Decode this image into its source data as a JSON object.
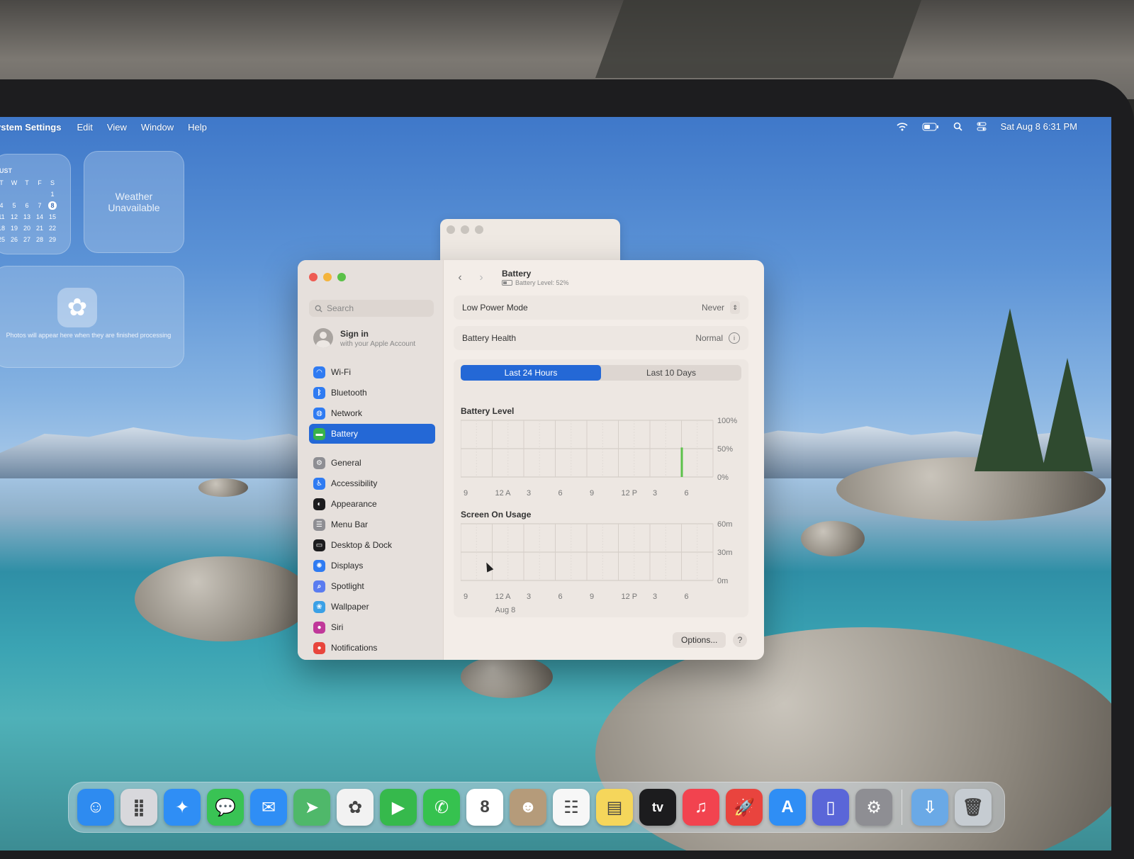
{
  "menubar": {
    "app_name": "ystem Settings",
    "items": [
      "Edit",
      "View",
      "Window",
      "Help"
    ],
    "clock": "Sat Aug 8  6:31 PM",
    "status_icons": [
      "wifi-icon",
      "battery-icon",
      "search-icon",
      "control-center-icon"
    ]
  },
  "widgets": {
    "calendar": {
      "month": "UST",
      "weekdays": [
        "T",
        "W",
        "T",
        "F",
        "S"
      ],
      "rows": [
        [
          "",
          "",
          "",
          "",
          "1"
        ],
        [
          "4",
          "5",
          "6",
          "7",
          "8"
        ],
        [
          "11",
          "12",
          "13",
          "14",
          "15"
        ],
        [
          "18",
          "19",
          "20",
          "21",
          "22"
        ],
        [
          "25",
          "26",
          "27",
          "28",
          "29"
        ]
      ],
      "today": "8"
    },
    "weather_text": "Weather Unavailable",
    "photos_text": "Photos will appear here when they are finished processing"
  },
  "sidebar": {
    "search_placeholder": "Search",
    "signin_title": "Sign in",
    "signin_subtitle": "with your Apple Account",
    "items": [
      {
        "label": "Wi-Fi",
        "color": "#2f7bf2",
        "glyph": "◠"
      },
      {
        "label": "Bluetooth",
        "color": "#2f7bf2",
        "glyph": "ᛒ"
      },
      {
        "label": "Network",
        "color": "#2f7bf2",
        "glyph": "◍"
      },
      {
        "label": "Battery",
        "color": "#38b24a",
        "glyph": "▬",
        "active": true
      },
      {
        "label": "General",
        "color": "#8e8e93",
        "glyph": "⚙"
      },
      {
        "label": "Accessibility",
        "color": "#2f7bf2",
        "glyph": "♿"
      },
      {
        "label": "Appearance",
        "color": "#1c1c1e",
        "glyph": "◐"
      },
      {
        "label": "Menu Bar",
        "color": "#8e8e93",
        "glyph": "☰"
      },
      {
        "label": "Desktop & Dock",
        "color": "#1c1c1e",
        "glyph": "▭"
      },
      {
        "label": "Displays",
        "color": "#2f7bf2",
        "glyph": "✺"
      },
      {
        "label": "Spotlight",
        "color": "#5a7cf0",
        "glyph": "⌕"
      },
      {
        "label": "Wallpaper",
        "color": "#3aa0e6",
        "glyph": "❀"
      },
      {
        "label": "Siri",
        "color": "#c0389a",
        "glyph": "●"
      },
      {
        "label": "Notifications",
        "color": "#e8453c",
        "glyph": "●"
      }
    ]
  },
  "content": {
    "title": "Battery",
    "subtitle": "Battery Level: 52%",
    "low_power_label": "Low Power Mode",
    "low_power_value": "Never",
    "health_label": "Battery Health",
    "health_value": "Normal",
    "segments": [
      "Last 24 Hours",
      "Last 10 Days"
    ],
    "selected_segment": 0,
    "options_label": "Options...",
    "help_label": "?"
  },
  "chart_data": [
    {
      "type": "bar",
      "title": "Battery Level",
      "xlabel": "",
      "ylabel": "",
      "categories": [
        "9",
        "12 A",
        "3",
        "6",
        "9",
        "12 P",
        "3",
        "6"
      ],
      "y_ticks": [
        "100%",
        "50%",
        "0%"
      ],
      "ylim": [
        0,
        100
      ],
      "bar_color": "#5cc24a",
      "points": [
        {
          "x": "6 PM",
          "value": 52
        }
      ]
    },
    {
      "type": "bar",
      "title": "Screen On Usage",
      "xlabel": "",
      "ylabel": "",
      "categories": [
        "9",
        "12 A",
        "3",
        "6",
        "9",
        "12 P",
        "3",
        "6"
      ],
      "date_label": "Aug 8",
      "y_ticks": [
        "60m",
        "30m",
        "0m"
      ],
      "ylim": [
        0,
        60
      ],
      "points": []
    }
  ],
  "dock": [
    {
      "name": "finder",
      "color": "#2e8bf0",
      "glyph": "☺"
    },
    {
      "name": "launchpad",
      "color": "#d8d8dc",
      "glyph": "⣿"
    },
    {
      "name": "safari",
      "color": "#2f8ef5",
      "glyph": "✦"
    },
    {
      "name": "messages",
      "color": "#39c354",
      "glyph": "💬"
    },
    {
      "name": "mail",
      "color": "#2f8ef5",
      "glyph": "✉"
    },
    {
      "name": "maps",
      "color": "#4fb86a",
      "glyph": "➤"
    },
    {
      "name": "photos",
      "color": "#f2f2f2",
      "glyph": "✿"
    },
    {
      "name": "facetime",
      "color": "#36b94c",
      "glyph": "▶"
    },
    {
      "name": "phone",
      "color": "#36c24f",
      "glyph": "✆"
    },
    {
      "name": "calendar",
      "color": "#ffffff",
      "glyph": "8"
    },
    {
      "name": "contacts",
      "color": "#b59b7a",
      "glyph": "☻"
    },
    {
      "name": "reminders",
      "color": "#f7f7f7",
      "glyph": "☷"
    },
    {
      "name": "notes",
      "color": "#f5d65b",
      "glyph": "▤"
    },
    {
      "name": "tv",
      "color": "#1c1c1e",
      "glyph": "tv"
    },
    {
      "name": "music",
      "color": "#f2434f",
      "glyph": "♫"
    },
    {
      "name": "rocket",
      "color": "#e9443e",
      "glyph": "🚀"
    },
    {
      "name": "app-store",
      "color": "#2f8ef5",
      "glyph": "A"
    },
    {
      "name": "iphone-mirroring",
      "color": "#5a66d8",
      "glyph": "▯"
    },
    {
      "name": "system-settings",
      "color": "#8e8e93",
      "glyph": "⚙"
    },
    {
      "name": "downloads",
      "color": "#6aa9e6",
      "glyph": "⇩"
    },
    {
      "name": "trash",
      "color": "#c6ccd2",
      "glyph": "🗑"
    }
  ]
}
